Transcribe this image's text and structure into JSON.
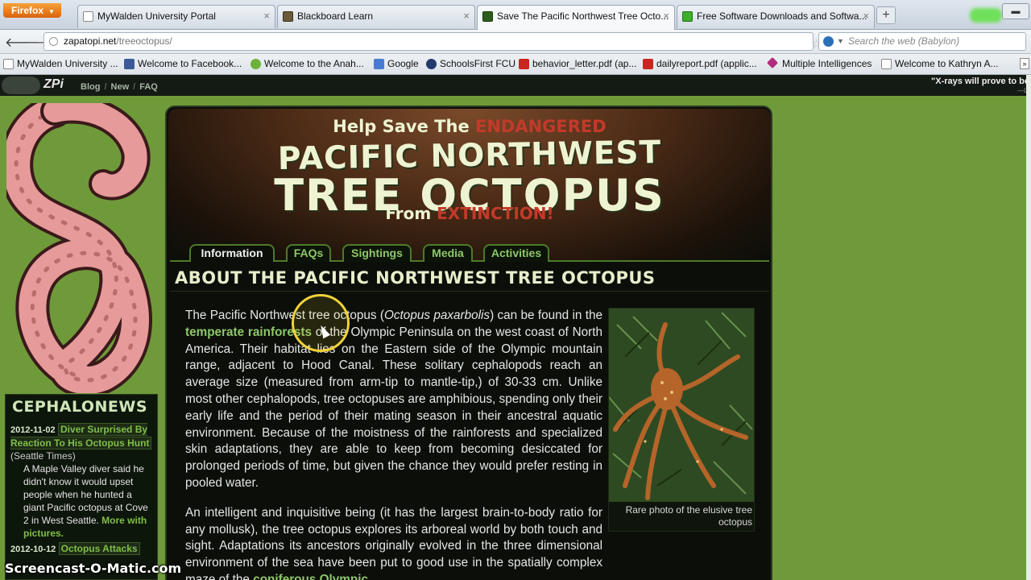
{
  "browser": {
    "menu_label": "Firefox",
    "tabs": [
      {
        "label": "MyWalden University Portal"
      },
      {
        "label": "Blackboard Learn"
      },
      {
        "label": "Save The Pacific Northwest Tree Octo..."
      },
      {
        "label": "Free Software Downloads and Softwa..."
      }
    ],
    "new_tab": "+",
    "url_host": "zapatopi.net",
    "url_path": "/treeoctopus/",
    "search_placeholder": "Search the web (Babylon)",
    "bookmarks": [
      {
        "label": "MyWalden University ...",
        "icon": "blank-page-icon"
      },
      {
        "label": "Welcome to Facebook...",
        "icon": "facebook-icon"
      },
      {
        "label": "Welcome to the Anah...",
        "icon": "apple-icon"
      },
      {
        "label": "Google",
        "icon": "google-icon"
      },
      {
        "label": "SchoolsFirst FCU",
        "icon": "schoolsfirst-icon"
      },
      {
        "label": "behavior_letter.pdf (ap...",
        "icon": "pdf-icon"
      },
      {
        "label": "dailyreport.pdf (applic...",
        "icon": "pdf-icon"
      },
      {
        "label": "Multiple Intelligences",
        "icon": "mi-icon"
      },
      {
        "label": "Welcome to Kathryn A...",
        "icon": "blank-page-icon"
      }
    ]
  },
  "site": {
    "logo_text": "ZPi",
    "nav": [
      "Blog",
      "New",
      "FAQ"
    ],
    "ticker": "\"X-rays will prove to be",
    "ticker_sub": "—Lo"
  },
  "banner": {
    "help_prefix": "Help Save The",
    "help_emph": "ENDANGERED",
    "title_line1": "PACIFIC NORTHWEST",
    "title_line2": "TREE OCTOPUS",
    "from_prefix": "From",
    "from_emph": "EXTINCTION!"
  },
  "tabs": [
    {
      "label": "Information",
      "active": true
    },
    {
      "label": "FAQs",
      "active": false
    },
    {
      "label": "Sightings",
      "active": false
    },
    {
      "label": "Media",
      "active": false
    },
    {
      "label": "Activities",
      "active": false
    }
  ],
  "section_title": "ABOUT THE PACIFIC NORTHWEST TREE OCTOPUS",
  "article": {
    "p1_a": "The Pacific Northwest tree octopus (",
    "p1_sci": "Octopus paxarbolis",
    "p1_b": ") can be found in the ",
    "p1_link": "temperate rainforests",
    "p1_c": " of the Olympic Peninsula on the west coast of North America. Their habitat lies on the Eastern side of the Olympic mountain range, adjacent to Hood Canal. These solitary cephalopods reach an average size (measured from arm-tip to mantle-tip,) of 30-33 cm. Unlike most other cephalopods, tree octopuses are amphibious, spending only their early life and the period of their mating season in their ancestral aquatic environment. Because of the moistness of the rainforests and specialized skin adaptations, they are able to keep from becoming desiccated for prolonged periods of time, but given the chance they would prefer resting in pooled water.",
    "p2_a": "An intelligent and inquisitive being (it has the largest brain-to-body ratio for any mollusk), the tree octopus explores its arboreal world by both touch and sight. Adaptations its ancestors originally evolved in the three dimensional environment of the sea have been put to good use in the spatially complex maze of the ",
    "p2_link": "coniferous Olympic"
  },
  "photo": {
    "caption": "Rare photo of the elusive tree octopus"
  },
  "news": {
    "title": "CEPHALONEWS",
    "items": [
      {
        "date": "2012-11-02",
        "headline": "Diver Surprised By Reaction To His Octopus Hunt",
        "source": "(Seattle Times)",
        "body": "A Maple Valley diver said he didn't know it would upset people when he hunted a giant Pacific octopus at Cove 2 in West Seattle.",
        "more": "More with pictures."
      },
      {
        "date": "2012-10-12",
        "headline": "Octopus Attacks"
      }
    ]
  },
  "overlay": {
    "watermark": "Screencast-O-Matic.com"
  },
  "colors": {
    "page_bg": "#6f9a3a",
    "panel_bg": "#0b0e09",
    "accent_green": "#8ec86a",
    "accent_red": "#c33a2a",
    "title_cream": "#eef4d2"
  }
}
